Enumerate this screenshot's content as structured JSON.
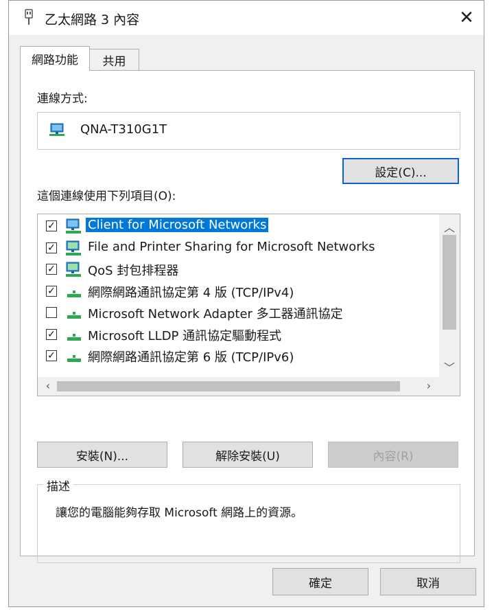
{
  "window": {
    "title": "乙太網路 3 內容",
    "close_glyph": "✕"
  },
  "tabs": [
    {
      "label": "網路功能",
      "active": true
    },
    {
      "label": "共用",
      "active": false
    }
  ],
  "connection": {
    "label": "連線方式:",
    "adapter_name": "QNA-T310G1T",
    "configure_label": "設定(C)..."
  },
  "items_section": {
    "label": "這個連線使用下列項目(O):",
    "items": [
      {
        "checked": true,
        "label": "Client for Microsoft Networks",
        "icon": "network-client-icon",
        "selected": true
      },
      {
        "checked": true,
        "label": "File and Printer Sharing for Microsoft Networks",
        "icon": "network-service-icon",
        "selected": false
      },
      {
        "checked": true,
        "label": "QoS 封包排程器",
        "icon": "network-service-icon",
        "selected": false
      },
      {
        "checked": true,
        "label": "網際網路通訊協定第 4 版 (TCP/IPv4)",
        "icon": "protocol-icon",
        "selected": false
      },
      {
        "checked": false,
        "label": "Microsoft Network Adapter 多工器通訊協定",
        "icon": "protocol-icon",
        "selected": false
      },
      {
        "checked": true,
        "label": "Microsoft LLDP 通訊協定驅動程式",
        "icon": "protocol-icon",
        "selected": false
      },
      {
        "checked": true,
        "label": "網際網路通訊協定第 6 版 (TCP/IPv6)",
        "icon": "protocol-icon",
        "selected": false
      }
    ]
  },
  "buttons": {
    "install": "安裝(N)...",
    "uninstall": "解除安裝(U)",
    "properties": "內容(R)"
  },
  "description": {
    "legend": "描述",
    "text": "讓您的電腦能夠存取 Microsoft 網路上的資源。"
  },
  "footer": {
    "ok": "確定",
    "cancel": "取消"
  },
  "colors": {
    "selection": "#0078d7",
    "focus_border": "#0a64c9",
    "dialog_bg": "#f0f0f0"
  }
}
